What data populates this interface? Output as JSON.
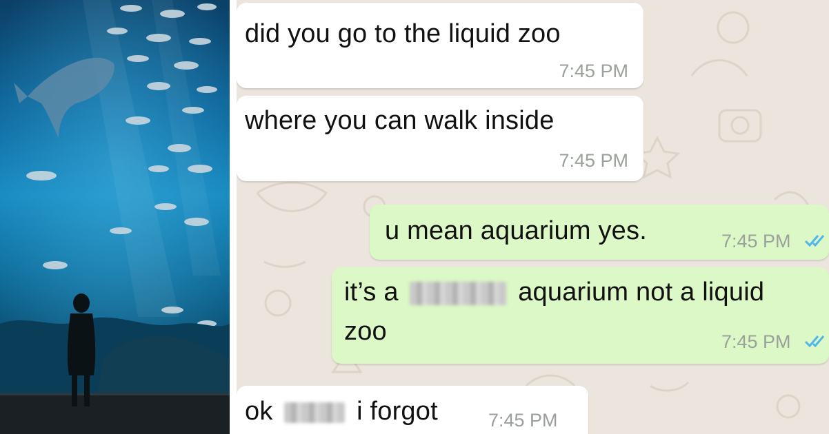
{
  "photo": {
    "subject": "aquarium-with-person-silhouette"
  },
  "colors": {
    "incoming_bubble": "#ffffff",
    "outgoing_bubble": "#dcf8c6",
    "wallpaper": "#ece5dd",
    "timestamp": "#9aa09a",
    "read_ticks": "#4fb6ec"
  },
  "messages": [
    {
      "direction": "incoming",
      "text": "did you go to the liquid zoo",
      "time": "7:45 PM"
    },
    {
      "direction": "incoming",
      "text": "where you can walk inside",
      "time": "7:45 PM"
    },
    {
      "direction": "outgoing",
      "text": "u mean aquarium yes.",
      "time": "7:45 PM",
      "status_icon": "double-check-icon"
    },
    {
      "direction": "outgoing",
      "text_before": "it’s a",
      "text_after": "aquarium not a liquid",
      "text_line2": "zoo",
      "time": "7:45 PM",
      "status_icon": "double-check-icon"
    },
    {
      "direction": "incoming",
      "text_before": "ok",
      "text_after": "i forgot",
      "time": "7:45 PM"
    }
  ]
}
